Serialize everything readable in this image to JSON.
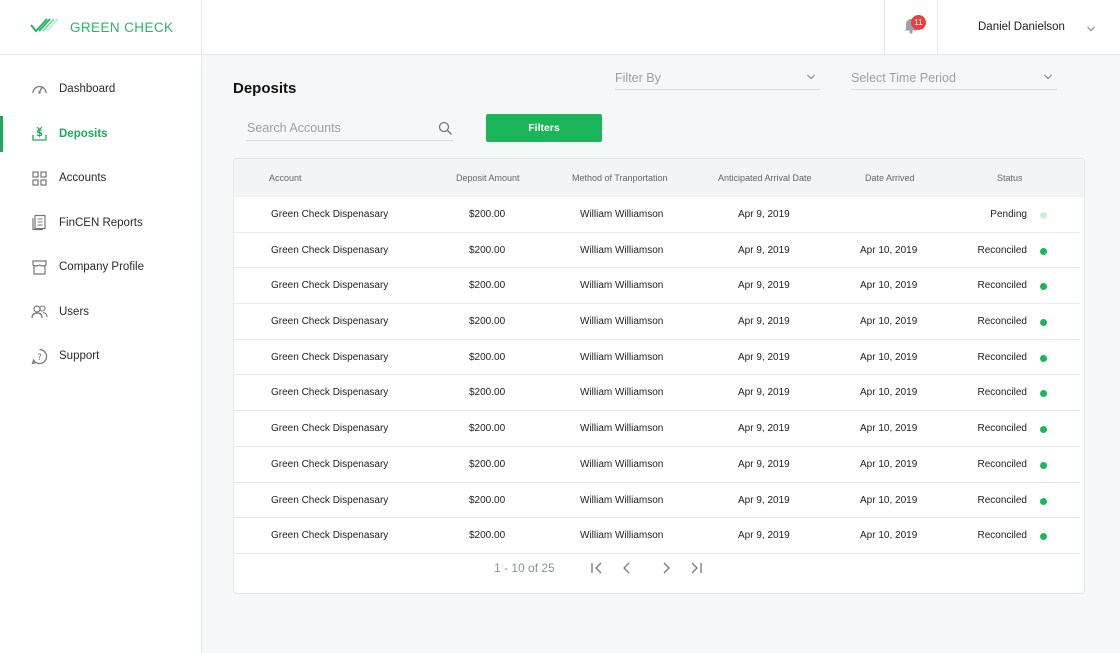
{
  "brand": {
    "name": "GREEN CHECK",
    "color": "#21a95a"
  },
  "sidebar": {
    "items": [
      {
        "label": "Dashboard",
        "icon": "dashboard-icon",
        "active": false
      },
      {
        "label": "Deposits",
        "icon": "deposit-icon",
        "active": true
      },
      {
        "label": "Accounts",
        "icon": "grid-icon",
        "active": false
      },
      {
        "label": "FinCEN Reports",
        "icon": "report-icon",
        "active": false
      },
      {
        "label": "Company Profile",
        "icon": "store-icon",
        "active": false
      },
      {
        "label": "Users",
        "icon": "users-icon",
        "active": false
      },
      {
        "label": "Support",
        "icon": "help-icon",
        "active": false
      }
    ]
  },
  "header": {
    "notifications": {
      "icon": "bell-icon",
      "count": "11"
    },
    "user_name": "Daniel Danielson"
  },
  "main": {
    "title": "Deposits",
    "filter_by": "Filter By",
    "time_period": "Select Time Period",
    "search_placeholder": "Search Accounts",
    "filters_button": "Filters"
  },
  "table": {
    "columns": [
      "Account",
      "Deposit Amount",
      "Method of Tranportation",
      "Anticipated Arrival Date",
      "Date Arrived",
      "Status"
    ],
    "rows": [
      {
        "account": "Green Check Dispenasary",
        "amount": "$200.00",
        "method": "William Williamson",
        "anticipated": "Apr 9, 2019",
        "arrived": "",
        "status": "Pending"
      },
      {
        "account": "Green Check Dispenasary",
        "amount": "$200.00",
        "method": "William Williamson",
        "anticipated": "Apr 9, 2019",
        "arrived": "Apr 10, 2019",
        "status": "Reconciled"
      },
      {
        "account": "Green Check Dispenasary",
        "amount": "$200.00",
        "method": "William Williamson",
        "anticipated": "Apr 9, 2019",
        "arrived": "Apr 10, 2019",
        "status": "Reconciled"
      },
      {
        "account": "Green Check Dispenasary",
        "amount": "$200.00",
        "method": "William Williamson",
        "anticipated": "Apr 9, 2019",
        "arrived": "Apr 10, 2019",
        "status": "Reconciled"
      },
      {
        "account": "Green Check Dispenasary",
        "amount": "$200.00",
        "method": "William Williamson",
        "anticipated": "Apr 9, 2019",
        "arrived": "Apr 10, 2019",
        "status": "Reconciled"
      },
      {
        "account": "Green Check Dispenasary",
        "amount": "$200.00",
        "method": "William Williamson",
        "anticipated": "Apr 9, 2019",
        "arrived": "Apr 10, 2019",
        "status": "Reconciled"
      },
      {
        "account": "Green Check Dispenasary",
        "amount": "$200.00",
        "method": "William Williamson",
        "anticipated": "Apr 9, 2019",
        "arrived": "Apr 10, 2019",
        "status": "Reconciled"
      },
      {
        "account": "Green Check Dispenasary",
        "amount": "$200.00",
        "method": "William Williamson",
        "anticipated": "Apr 9, 2019",
        "arrived": "Apr 10, 2019",
        "status": "Reconciled"
      },
      {
        "account": "Green Check Dispenasary",
        "amount": "$200.00",
        "method": "William Williamson",
        "anticipated": "Apr 9, 2019",
        "arrived": "Apr 10, 2019",
        "status": "Reconciled"
      },
      {
        "account": "Green Check Dispenasary",
        "amount": "$200.00",
        "method": "William Williamson",
        "anticipated": "Apr 9, 2019",
        "arrived": "Apr 10, 2019",
        "status": "Reconciled"
      }
    ],
    "status_colors": {
      "Pending": "#c9f0d8",
      "Reconciled": "#1db55a"
    }
  },
  "pagination": {
    "text": "1 - 10 of 25",
    "buttons": [
      "first-page-icon",
      "prev-page-icon",
      "next-page-icon",
      "last-page-icon"
    ]
  }
}
